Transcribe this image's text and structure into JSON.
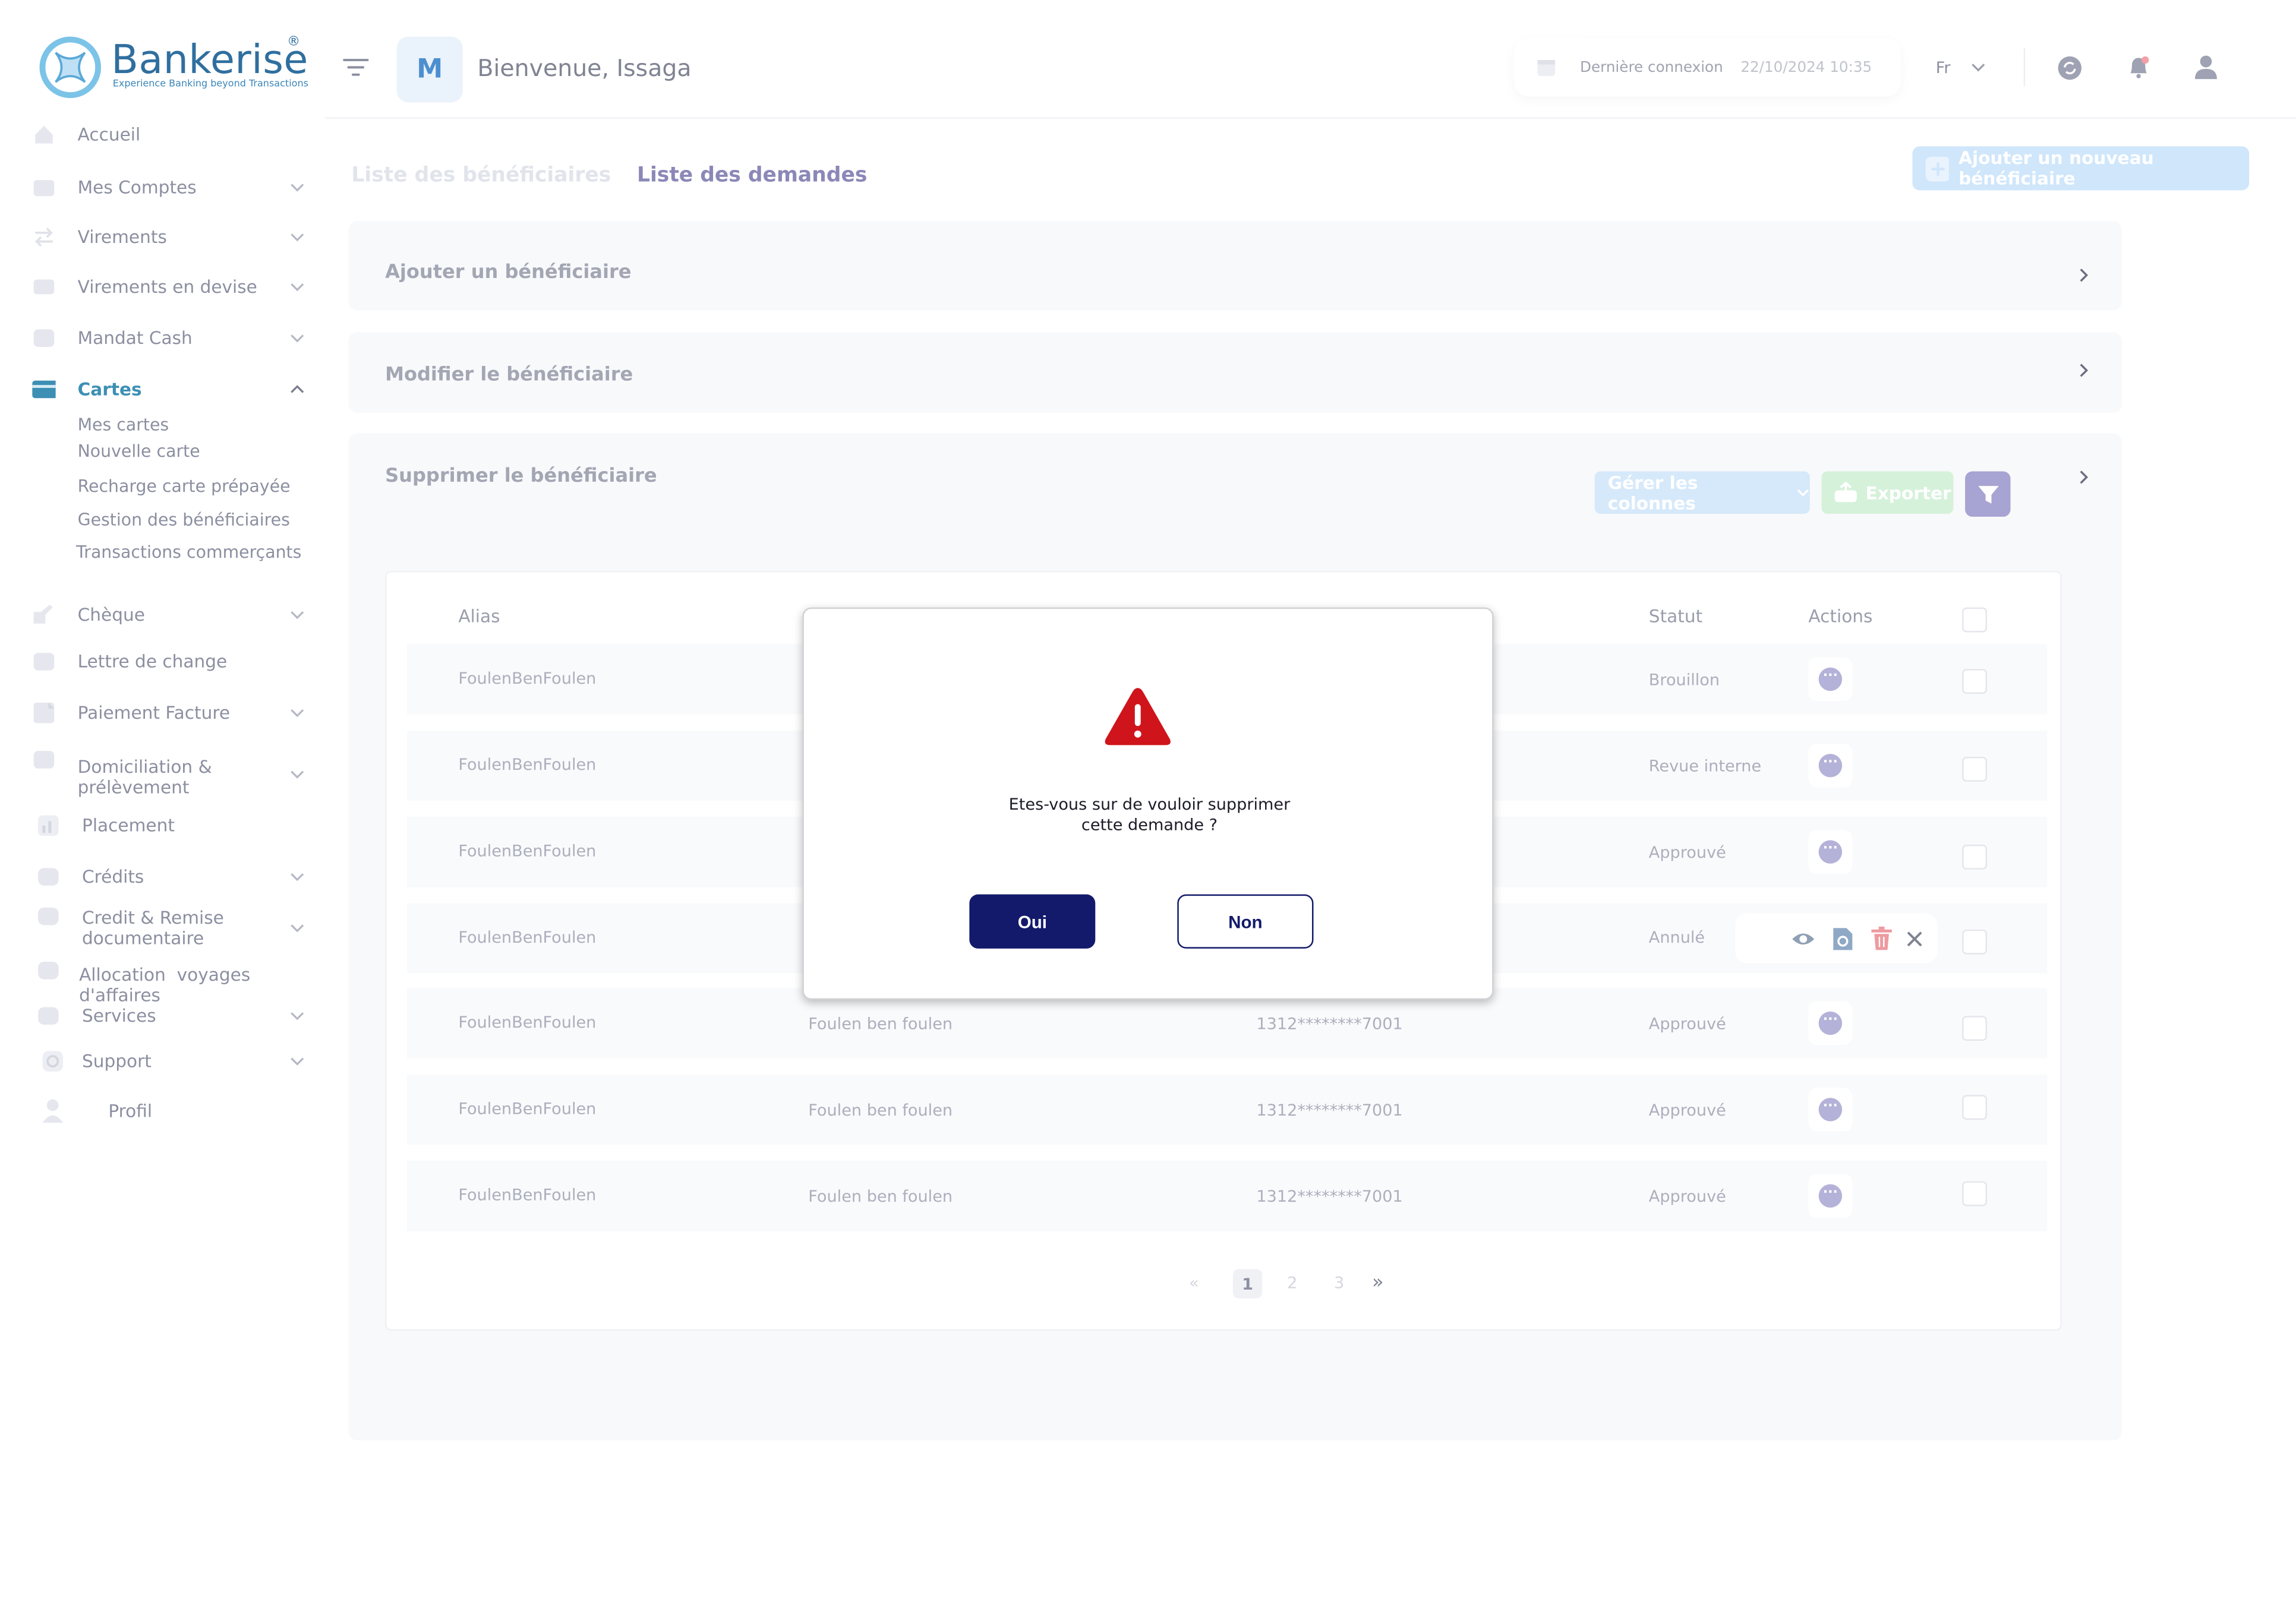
{
  "brand": {
    "name": "Bankerise",
    "tagline": "Experience Banking beyond Transactions",
    "reg": "®"
  },
  "header": {
    "avatar_letter": "M",
    "welcome": "Bienvenue, Issaga",
    "last_login_label": "Dernière  connexion",
    "last_login_value": "22/10/2024 10:35",
    "language": "Fr"
  },
  "sidebar": {
    "items": [
      {
        "label": "Accueil",
        "icon": "home-icon"
      },
      {
        "label": "Mes Comptes",
        "icon": "folder-icon"
      },
      {
        "label": "Virements",
        "icon": "transfer-icon"
      },
      {
        "label": "Virements en devise",
        "icon": "currency-icon"
      },
      {
        "label": "Mandat Cash",
        "icon": "mandate-icon"
      },
      {
        "label": "Cartes",
        "icon": "card-icon"
      },
      {
        "label": "Chèque",
        "icon": "cheque-icon"
      },
      {
        "label": "Lettre de change",
        "icon": "letter-icon"
      },
      {
        "label": "Paiement Facture",
        "icon": "invoice-icon"
      },
      {
        "label": "Domiciliation &\nprélèvement",
        "icon": "domiciliation-icon"
      },
      {
        "label": "Placement",
        "icon": "placement-icon"
      },
      {
        "label": "Crédits",
        "icon": "credit-icon"
      },
      {
        "label": "Credit & Remise\ndocumentaire",
        "icon": "document-icon"
      },
      {
        "label": "Allocation  voyages\nd'affaires",
        "icon": "travel-icon"
      },
      {
        "label": "Services",
        "icon": "services-icon"
      },
      {
        "label": "Support",
        "icon": "support-icon"
      },
      {
        "label": "Profil",
        "icon": "user-icon"
      }
    ],
    "cartes_sub": [
      "Mes cartes",
      "Nouvelle carte",
      "Recharge carte prépayée",
      "Gestion des bénéficiaires",
      "Transactions commerçants"
    ]
  },
  "tabs": [
    "Liste des bénéficiaires",
    "Liste des demandes"
  ],
  "add_button": "Ajouter un nouveau bénéficiaire",
  "sections": [
    "Ajouter un bénéficiaire",
    "Modifier le bénéficiaire",
    "Supprimer le bénéficiaire"
  ],
  "toolbar": {
    "columns": "Gérer les colonnes",
    "export": "Exporter"
  },
  "table": {
    "headers": [
      "Alias",
      "Statut",
      "Actions"
    ],
    "rows": [
      {
        "alias": "FoulenBenFoulen",
        "name": "",
        "account": "",
        "status": "Brouillon"
      },
      {
        "alias": "FoulenBenFoulen",
        "name": "",
        "account": "",
        "status": "Revue interne"
      },
      {
        "alias": "FoulenBenFoulen",
        "name": "",
        "account": "",
        "status": "Approuvé"
      },
      {
        "alias": "FoulenBenFoulen",
        "name": "",
        "account": "",
        "status": "Annulé"
      },
      {
        "alias": "FoulenBenFoulen",
        "name": "Foulen ben foulen",
        "account": "1312********7001",
        "status": "Approuvé"
      },
      {
        "alias": "FoulenBenFoulen",
        "name": "Foulen ben foulen",
        "account": "1312********7001",
        "status": "Approuvé"
      },
      {
        "alias": "FoulenBenFoulen",
        "name": "Foulen ben foulen",
        "account": "1312********7001",
        "status": "Approuvé"
      }
    ],
    "dots": "···"
  },
  "pagination": {
    "first": "«",
    "pages": [
      "1",
      "2",
      "3"
    ],
    "last": "»",
    "current": "1"
  },
  "modal": {
    "message_line1": "Etes-vous sur de vouloir  supprimer",
    "message_line2": "cette demande  ?",
    "yes": "Oui",
    "no": "Non"
  },
  "colors": {
    "primary": "#131a6b",
    "danger": "#d0141b",
    "brand": "#2f6f9f"
  }
}
